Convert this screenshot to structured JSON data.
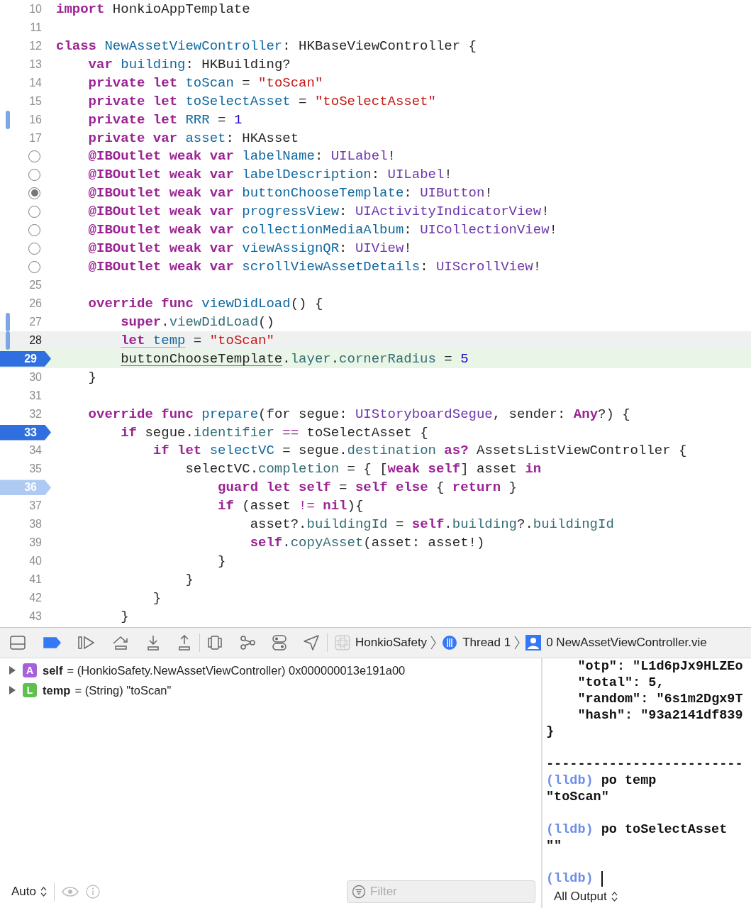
{
  "editor": {
    "lines": [
      {
        "number": "10",
        "code": "import HonkioAppTemplate",
        "change_bar": false,
        "cursor_line": false,
        "current": false,
        "breakpoint": false
      },
      {
        "number": "11",
        "change_bar": false,
        "cursor_line": false,
        "current": false,
        "breakpoint": false
      },
      {
        "number": "12",
        "code": "class NewAssetViewController: HKBaseViewController {",
        "change_bar": false,
        "cursor_line": false,
        "current": false,
        "breakpoint": false
      },
      {
        "number": "13",
        "code": "    var building: HKBuilding?",
        "change_bar": false,
        "cursor_line": false,
        "current": false,
        "breakpoint": false
      },
      {
        "number": "14",
        "code": "    private let toScan = \"toScan\"",
        "change_bar": false,
        "cursor_line": false,
        "current": false,
        "breakpoint": false
      },
      {
        "number": "15",
        "code": "    private let toSelectAsset = \"toSelectAsset\"",
        "change_bar": false,
        "cursor_line": false,
        "current": false,
        "breakpoint": false
      },
      {
        "number": "16",
        "code": "    private let RRR = 1",
        "change_bar": true,
        "cursor_line": false,
        "current": false,
        "breakpoint": false
      },
      {
        "number": "17",
        "code": "    private var asset: HKAsset",
        "change_bar": false,
        "cursor_line": false,
        "current": false,
        "breakpoint": false
      },
      {
        "outlet": true,
        "connected": false,
        "code": "    @IBOutlet weak var labelName: UILabel!",
        "change_bar": false,
        "cursor_line": false,
        "current": false,
        "breakpoint": false
      },
      {
        "outlet": true,
        "connected": false,
        "code": "    @IBOutlet weak var labelDescription: UILabel!",
        "change_bar": false,
        "cursor_line": false,
        "current": false,
        "breakpoint": false
      },
      {
        "outlet": true,
        "connected": true,
        "code": "    @IBOutlet weak var buttonChooseTemplate: UIButton!",
        "change_bar": false,
        "cursor_line": false,
        "current": false,
        "breakpoint": false
      },
      {
        "outlet": true,
        "connected": false,
        "code": "    @IBOutlet weak var progressView: UIActivityIndicatorView!",
        "change_bar": false,
        "cursor_line": false,
        "current": false,
        "breakpoint": false
      },
      {
        "outlet": true,
        "connected": false,
        "code": "    @IBOutlet weak var collectionMediaAlbum: UICollectionView!",
        "change_bar": false,
        "cursor_line": false,
        "current": false,
        "breakpoint": false
      },
      {
        "outlet": true,
        "connected": false,
        "code": "    @IBOutlet weak var viewAssignQR: UIView!",
        "change_bar": false,
        "cursor_line": false,
        "current": false,
        "breakpoint": false
      },
      {
        "outlet": true,
        "connected": false,
        "code": "    @IBOutlet weak var scrollViewAssetDetails: UIScrollView!",
        "change_bar": false,
        "cursor_line": false,
        "current": false,
        "breakpoint": false
      },
      {
        "number": "25",
        "change_bar": false,
        "cursor_line": false,
        "current": false,
        "breakpoint": false
      },
      {
        "number": "26",
        "code": "    override func viewDidLoad() {",
        "change_bar": false,
        "cursor_line": false,
        "current": false,
        "breakpoint": false
      },
      {
        "number": "27",
        "code": "        super.viewDidLoad()",
        "change_bar": true,
        "cursor_line": false,
        "current": false,
        "breakpoint": false
      },
      {
        "number": "28",
        "code": "        let temp = \"toScan\"",
        "warning_underline": true,
        "change_bar": true,
        "cursor_line": true,
        "current": false,
        "breakpoint": false
      },
      {
        "number": "29",
        "code": "        buttonChooseTemplate.layer.cornerRadius = 5",
        "focus_underline": true,
        "change_bar": false,
        "cursor_line": false,
        "current": true,
        "breakpoint": true,
        "disabled": false
      },
      {
        "number": "30",
        "code": "    }",
        "change_bar": false,
        "cursor_line": false,
        "current": false,
        "breakpoint": false
      },
      {
        "number": "31",
        "change_bar": false,
        "cursor_line": false,
        "current": false,
        "breakpoint": false
      },
      {
        "number": "32",
        "code": "    override func prepare(for segue: UIStoryboardSegue, sender: Any?) {",
        "change_bar": false,
        "cursor_line": false,
        "current": false,
        "breakpoint": false
      },
      {
        "number": "33",
        "code": "        if segue.identifier == toSelectAsset {",
        "change_bar": false,
        "cursor_line": false,
        "current": false,
        "breakpoint": true,
        "disabled": false
      },
      {
        "number": "34",
        "code": "            if let selectVC = segue.destination as? AssetsListViewController {",
        "change_bar": false,
        "cursor_line": false,
        "current": false,
        "breakpoint": false
      },
      {
        "number": "35",
        "code": "                selectVC.completion = { [weak self] asset in",
        "change_bar": false,
        "cursor_line": false,
        "current": false,
        "breakpoint": false
      },
      {
        "number": "36",
        "code": "                    guard let self = self else { return }",
        "change_bar": false,
        "cursor_line": false,
        "current": false,
        "breakpoint": true,
        "disabled": true
      },
      {
        "number": "37",
        "code": "                    if (asset != nil){",
        "change_bar": false,
        "cursor_line": false,
        "current": false,
        "breakpoint": false
      },
      {
        "number": "38",
        "code": "                        asset?.buildingId = self.building?.buildingId",
        "change_bar": false,
        "cursor_line": false,
        "current": false,
        "breakpoint": false
      },
      {
        "number": "39",
        "code": "                        self.copyAsset(asset: asset!)",
        "change_bar": false,
        "cursor_line": false,
        "current": false,
        "breakpoint": false
      },
      {
        "number": "40",
        "code": "                    }",
        "change_bar": false,
        "cursor_line": false,
        "current": false,
        "breakpoint": false
      },
      {
        "number": "41",
        "code": "                }",
        "change_bar": false,
        "cursor_line": false,
        "current": false,
        "breakpoint": false
      },
      {
        "number": "42",
        "code": "            }",
        "change_bar": false,
        "cursor_line": false,
        "current": false,
        "breakpoint": false
      },
      {
        "number": "43",
        "code": "        }",
        "change_bar": false,
        "cursor_line": false,
        "current": false,
        "breakpoint": false
      }
    ]
  },
  "debug_bar": {
    "breakpoints_enabled": true,
    "breadcrumbs": [
      {
        "kind": "app",
        "label": "HonkioSafety"
      },
      {
        "kind": "thread",
        "label": "Thread 1"
      },
      {
        "kind": "frame",
        "label": "0 NewAssetViewController.vie"
      }
    ]
  },
  "variables": [
    {
      "kind": "argument",
      "badge": "A",
      "name": "self",
      "value": "= (HonkioSafety.NewAssetViewController) 0x000000013e191a00",
      "expanded": false
    },
    {
      "kind": "local",
      "badge": "L",
      "name": "temp",
      "value": "= (String) \"toScan\"",
      "expanded": false
    }
  ],
  "variables_footer": {
    "scope": "Auto",
    "filter_placeholder": "Filter"
  },
  "console": {
    "lines": [
      {
        "kind": "output",
        "text": "    \"otp\": \"L1d6pJx9HLZEo"
      },
      {
        "kind": "output",
        "text": "    \"total\": 5,"
      },
      {
        "kind": "output",
        "text": "    \"random\": \"6s1m2Dgx9T"
      },
      {
        "kind": "output",
        "text": "    \"hash\": \"93a2141df839"
      },
      {
        "kind": "output",
        "text": "}"
      },
      {
        "kind": "blank"
      },
      {
        "kind": "output",
        "text": "-------------------------"
      },
      {
        "kind": "command",
        "prompt": "(lldb)",
        "text": "po temp",
        "cursor": false
      },
      {
        "kind": "output",
        "text": "\"toScan\""
      },
      {
        "kind": "blank"
      },
      {
        "kind": "command",
        "prompt": "(lldb)",
        "text": "po toSelectAsset",
        "cursor": false
      },
      {
        "kind": "output",
        "text": "\"\""
      },
      {
        "kind": "blank"
      },
      {
        "kind": "command",
        "prompt": "(lldb)",
        "cursor": true
      }
    ],
    "output_selector": "All Output"
  }
}
